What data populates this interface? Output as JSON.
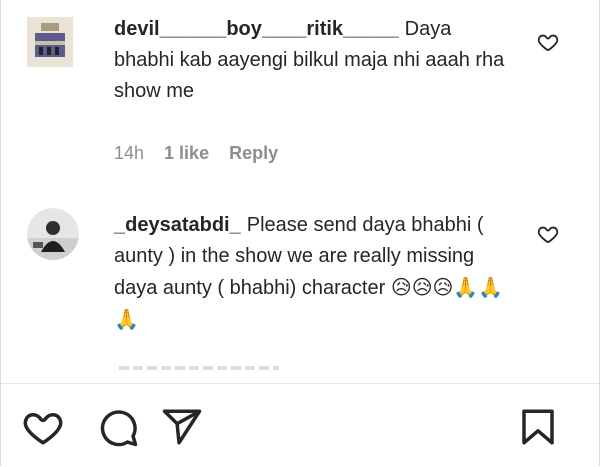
{
  "comments": [
    {
      "username": "devil______boy____ritik_____",
      "text": "Daya bhabhi kab aayengi bilkul maja nhi aaah rha show me",
      "time": "14h",
      "likes": "1 like",
      "reply": "Reply"
    },
    {
      "username": "_deysatabdi_",
      "text": "Please send daya bhabhi ( aunty ) in the show we are really missing daya aunty ( bhabhi) character",
      "emojis": "😥😥😥🙏🙏🙏"
    }
  ],
  "icons": {
    "comment_like": "heart-outline-icon",
    "like": "heart-icon",
    "comment": "comment-icon",
    "share": "send-icon",
    "save": "bookmark-icon"
  }
}
